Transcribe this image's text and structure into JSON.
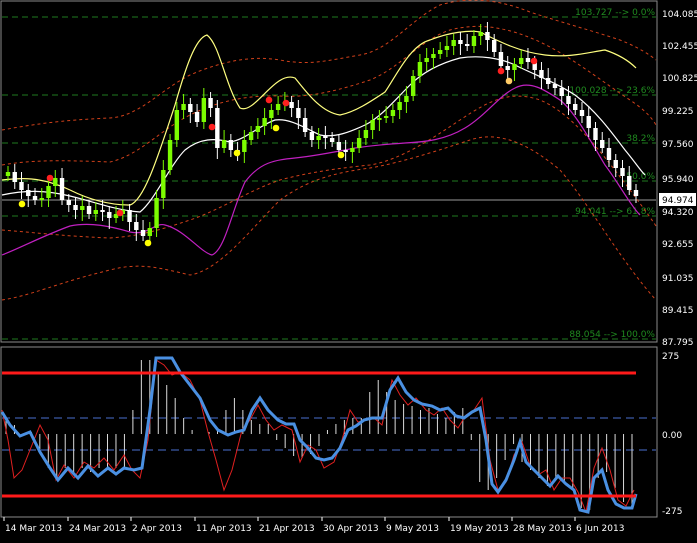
{
  "price_panel": {
    "y_ticks": [
      "104.085",
      "102.455",
      "100.825",
      "99.225",
      "97.560",
      "95.940",
      "94.320",
      "92.655",
      "91.035",
      "89.415",
      "87.795"
    ],
    "current_price": "94.974",
    "fib_levels": [
      {
        "label": "103.727 --> 0.0%"
      },
      {
        "label": "100.028 --> 23.6%"
      },
      {
        "label": "38.2%"
      },
      {
        "label": "50.0%"
      },
      {
        "label": "94.041 --> 61.8%"
      },
      {
        "label": "88.054 --> 100.0%"
      }
    ]
  },
  "oscillator_panel": {
    "y_ticks": [
      "275",
      "0.00",
      "-275"
    ]
  },
  "x_axis": {
    "labels": [
      "14 Mar 2013",
      "24 Mar 2013",
      "2 Apr 2013",
      "11 Apr 2013",
      "21 Apr 2013",
      "30 Apr 2013",
      "9 May 2013",
      "19 May 2013",
      "28 May 2013",
      "6 Jun 2013"
    ]
  },
  "colors": {
    "background": "#000000",
    "grid": "#1f7a1f",
    "bull_candle": "#7cfc00",
    "bear_candle": "#ffffff",
    "ma_fast": "#ffffff",
    "ma_slow": "#ffff80",
    "envelope": "#d0401a",
    "lower_line": "#c020c0",
    "oscillator_main": "#4a90e2",
    "oscillator_signal": "#e02020",
    "level_line": "#ff1a1a",
    "dot_red": "#ff2020",
    "dot_yellow": "#ffff00",
    "dot_orange": "#ffcc66"
  }
}
